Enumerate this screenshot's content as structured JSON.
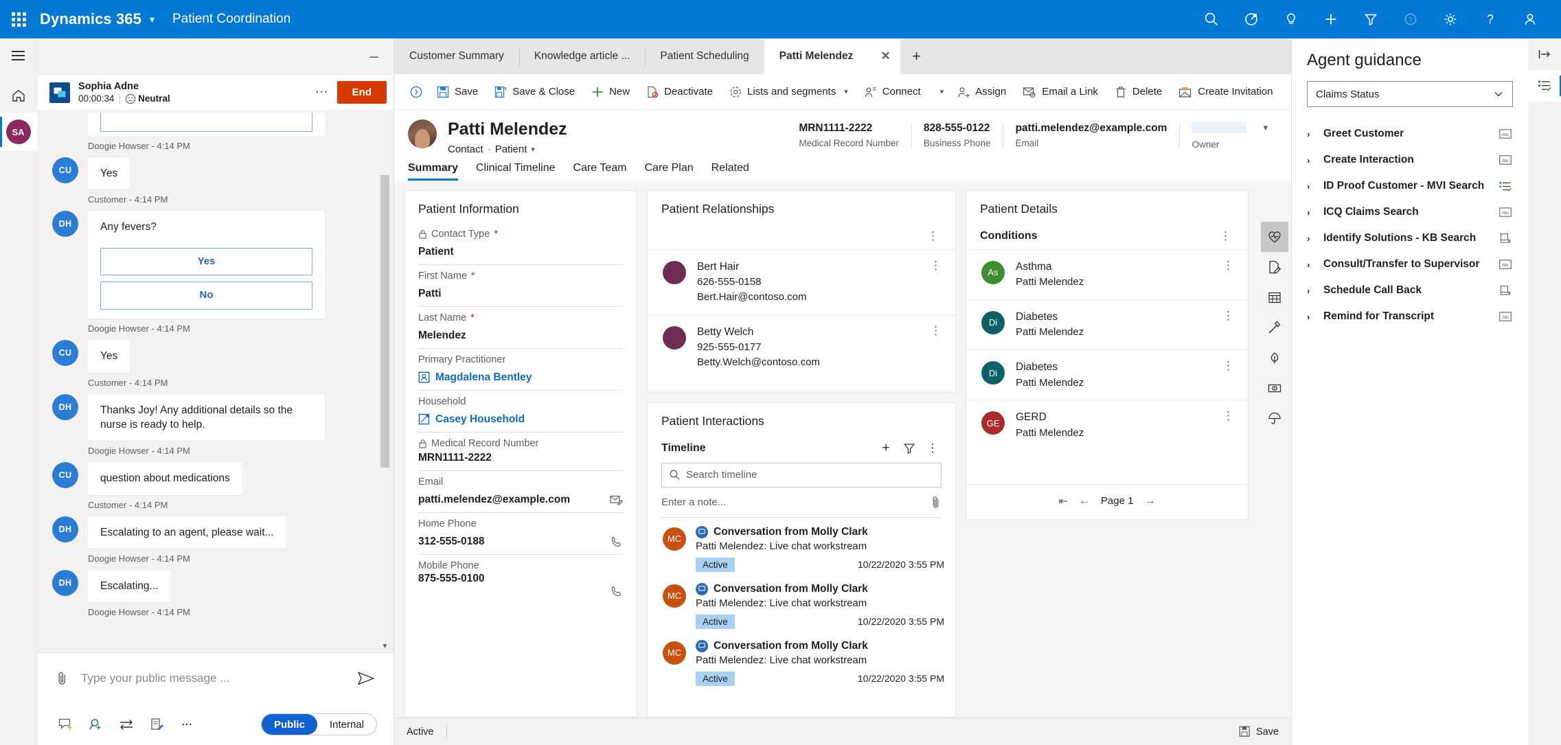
{
  "topbar": {
    "brand": "Dynamics 365",
    "app_name": "Patient Coordination",
    "icons": [
      "search-icon",
      "assistant-icon",
      "insights-icon",
      "quick-create-icon",
      "filter-icon",
      "help-circle-icon",
      "gear-icon",
      "question-icon",
      "user-icon"
    ]
  },
  "chat": {
    "customer_name": "Sophia Adne",
    "timer": "00:00:34",
    "sentiment": "Neutral",
    "end_label": "End",
    "messages": [
      {
        "kind": "partial",
        "author": "Doogie Howser",
        "time": "4:14 PM"
      },
      {
        "kind": "text",
        "initials": "CU",
        "avatar": "cu",
        "text": "Yes",
        "author": "Customer",
        "time": "4:14 PM"
      },
      {
        "kind": "choice",
        "initials": "DH",
        "avatar": "dh",
        "title": "Any fevers?",
        "options": [
          "Yes",
          "No"
        ],
        "author": "Doogie Howser",
        "time": "4:14 PM"
      },
      {
        "kind": "text",
        "initials": "CU",
        "avatar": "cu",
        "text": "Yes",
        "author": "Customer",
        "time": "4:14 PM"
      },
      {
        "kind": "text",
        "initials": "DH",
        "avatar": "dh",
        "text": "Thanks Joy! Any additional details so the nurse is ready to help.",
        "author": "Doogie Howser",
        "time": "4:14 PM"
      },
      {
        "kind": "text",
        "initials": "CU",
        "avatar": "cu",
        "text": "question about medications",
        "author": "Customer",
        "time": "4:14 PM"
      },
      {
        "kind": "text",
        "initials": "DH",
        "avatar": "dh",
        "text": "Escalating to an agent, please wait...",
        "author": "Doogie Howser",
        "time": "4:14 PM"
      },
      {
        "kind": "text",
        "initials": "DH",
        "avatar": "dh",
        "text": "Escalating...",
        "author": "Doogie Howser",
        "time": "4:14 PM"
      }
    ],
    "composer_placeholder": "Type your public message ...",
    "toggle_public": "Public",
    "toggle_internal": "Internal"
  },
  "tabs": {
    "items": [
      {
        "label": "Customer Summary",
        "active": false
      },
      {
        "label": "Knowledge article ...",
        "active": false
      },
      {
        "label": "Patient Scheduling",
        "active": false
      },
      {
        "label": "Patti Melendez",
        "active": true
      }
    ],
    "add_label": "+"
  },
  "commandbar": {
    "items": [
      {
        "label": "Save",
        "icon": "save-icon",
        "caret": false
      },
      {
        "label": "Save & Close",
        "icon": "save-close-icon",
        "caret": false
      },
      {
        "label": "New",
        "icon": "plus-icon",
        "caret": false
      },
      {
        "label": "Deactivate",
        "icon": "deactivate-icon",
        "caret": false
      },
      {
        "label": "Lists and segments",
        "icon": "lists-icon",
        "caret": true
      },
      {
        "label": "Connect",
        "icon": "connect-icon",
        "caret": true
      },
      {
        "label": "Assign",
        "icon": "assign-icon",
        "caret": false
      },
      {
        "label": "Email a Link",
        "icon": "email-link-icon",
        "caret": false
      },
      {
        "label": "Delete",
        "icon": "trash-icon",
        "caret": false
      },
      {
        "label": "Create Invitation",
        "icon": "invitation-icon",
        "caret": false
      }
    ],
    "overflow": "⋮"
  },
  "record": {
    "title": "Patti Melendez",
    "subtype_a": "Contact",
    "subtype_b": "Patient",
    "header_fields": [
      {
        "value": "MRN1111-2222",
        "label": "Medical Record Number"
      },
      {
        "value": "828-555-0122",
        "label": "Business Phone"
      },
      {
        "value": "patti.melendez@example.com",
        "label": "Email"
      },
      {
        "value": "",
        "label": "Owner"
      }
    ],
    "tabs": [
      "Summary",
      "Clinical Timeline",
      "Care Team",
      "Care Plan",
      "Related"
    ],
    "active_tab": "Summary"
  },
  "patient_information": {
    "title": "Patient Information",
    "fields": [
      {
        "label": "Contact Type",
        "value": "Patient",
        "required": true,
        "locked": true,
        "link": false,
        "action": ""
      },
      {
        "label": "First Name",
        "value": "Patti",
        "required": true,
        "required_color": "blue",
        "locked": false,
        "link": false,
        "action": ""
      },
      {
        "label": "Last Name",
        "value": "Melendez",
        "required": true,
        "locked": false,
        "link": false,
        "action": ""
      },
      {
        "label": "Primary Practitioner",
        "value": "Magdalena Bentley",
        "required": false,
        "locked": false,
        "link": true,
        "link_icon": "contact-card-icon",
        "action": ""
      },
      {
        "label": "Household",
        "value": "Casey Household",
        "required": false,
        "locked": false,
        "link": true,
        "link_icon": "household-icon",
        "action": ""
      },
      {
        "label": "Medical Record Number",
        "value": "MRN1111-2222",
        "required": false,
        "locked": true,
        "link": false,
        "action": ""
      },
      {
        "label": "Email",
        "value": "patti.melendez@example.com",
        "required": false,
        "locked": false,
        "link": false,
        "action": "email-icon"
      },
      {
        "label": "Home Phone",
        "value": "312-555-0188",
        "required": false,
        "locked": false,
        "link": false,
        "action": "phone-icon"
      },
      {
        "label": "Mobile Phone",
        "value": "875-555-0100",
        "required": false,
        "locked": false,
        "link": false,
        "action": "phone-icon"
      }
    ]
  },
  "patient_relationships": {
    "title": "Patient Relationships",
    "rows": [
      {
        "name": "Bert Hair",
        "phone": "626-555-0158",
        "email": "Bert.Hair@contoso.com",
        "color": "#6d2c54"
      },
      {
        "name": "Betty Welch",
        "phone": "925-555-0177",
        "email": "Betty.Welch@contoso.com",
        "color": "#6d2c54"
      }
    ]
  },
  "patient_interactions": {
    "title": "Patient Interactions",
    "timeline_label": "Timeline",
    "search_placeholder": "Search timeline",
    "note_placeholder": "Enter a note...",
    "items": [
      {
        "initials": "MC",
        "title": "Conversation from Molly Clark",
        "subtitle": "Patti Melendez: Live chat workstream",
        "state": "Active",
        "when": "10/22/2020 3:55 PM"
      },
      {
        "initials": "MC",
        "title": "Conversation from Molly Clark",
        "subtitle": "Patti Melendez: Live chat workstream",
        "state": "Active",
        "when": "10/22/2020 3:55 PM"
      },
      {
        "initials": "MC",
        "title": "Conversation from Molly Clark",
        "subtitle": "Patti Melendez: Live chat workstream",
        "state": "Active",
        "when": "10/22/2020 3:55 PM"
      }
    ]
  },
  "patient_details": {
    "title": "Patient Details",
    "conditions_label": "Conditions",
    "conditions": [
      {
        "initials": "As",
        "name": "Asthma",
        "patient": "Patti Melendez",
        "color": "#3e8e2f"
      },
      {
        "initials": "Di",
        "name": "Diabetes",
        "patient": "Patti Melendez",
        "color": "#0e6169"
      },
      {
        "initials": "Di",
        "name": "Diabetes",
        "patient": "Patti Melendez",
        "color": "#0e6169"
      },
      {
        "initials": "GE",
        "name": "GERD",
        "patient": "Patti Melendez",
        "color": "#a92b2b"
      }
    ],
    "pager": {
      "first": "⇤",
      "prev": "←",
      "page": "Page 1",
      "next": "→"
    }
  },
  "canvas_rail": [
    "heart-pulse-icon",
    "document-edit-icon",
    "calendar-icon",
    "syringe-icon",
    "allergy-leaf-icon",
    "payment-card-icon",
    "insurance-umbrella-icon"
  ],
  "agent_guidance": {
    "title": "Agent guidance",
    "selected_script": "Claims Status",
    "items": [
      {
        "label": "Greet Customer",
        "icon": "text-block-icon"
      },
      {
        "label": "Create Interaction",
        "icon": "text-block-icon"
      },
      {
        "label": "ID Proof Customer - MVI Search",
        "icon": "checklist-icon"
      },
      {
        "label": "ICQ Claims Search",
        "icon": "text-block-icon"
      },
      {
        "label": "Identify Solutions - KB Search",
        "icon": "script-icon"
      },
      {
        "label": "Consult/Transfer to Supervisor",
        "icon": "text-block-icon"
      },
      {
        "label": "Schedule Call Back",
        "icon": "script-icon"
      },
      {
        "label": "Remind for Transcript",
        "icon": "text-block-icon"
      }
    ],
    "rail": [
      "expand-panel-icon",
      "checklist-icon"
    ]
  },
  "statusbar": {
    "state": "Active",
    "save_label": "Save"
  },
  "colors": {
    "brand_blue": "#0078d4",
    "end_red": "#d83b01",
    "link_blue": "#0f6cbd",
    "active_badge": "#a7d0f2"
  }
}
